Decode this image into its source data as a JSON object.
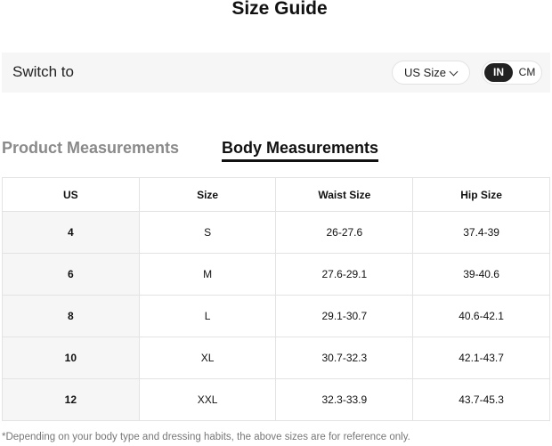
{
  "title": "Size Guide",
  "switch": {
    "label": "Switch to",
    "size_select": "US Size",
    "unit_in": "IN",
    "unit_cm": "CM",
    "active_unit": "IN"
  },
  "tabs": {
    "product": "Product Measurements",
    "body": "Body Measurements",
    "active": "body"
  },
  "table": {
    "headers": [
      "US",
      "Size",
      "Waist Size",
      "Hip Size"
    ],
    "rows": [
      [
        "4",
        "S",
        "26-27.6",
        "37.4-39"
      ],
      [
        "6",
        "M",
        "27.6-29.1",
        "39-40.6"
      ],
      [
        "8",
        "L",
        "29.1-30.7",
        "40.6-42.1"
      ],
      [
        "10",
        "XL",
        "30.7-32.3",
        "42.1-43.7"
      ],
      [
        "12",
        "XXL",
        "32.3-33.9",
        "43.7-45.3"
      ]
    ]
  },
  "footnote": "*Depending on your body type and dressing habits, the above sizes are for reference only.",
  "colors": {
    "accent": "#222222",
    "bar_bg": "#f6f6f6",
    "inactive_tab": "#8a8a8a"
  },
  "icons": {
    "size_select": "chevron-down-icon"
  }
}
